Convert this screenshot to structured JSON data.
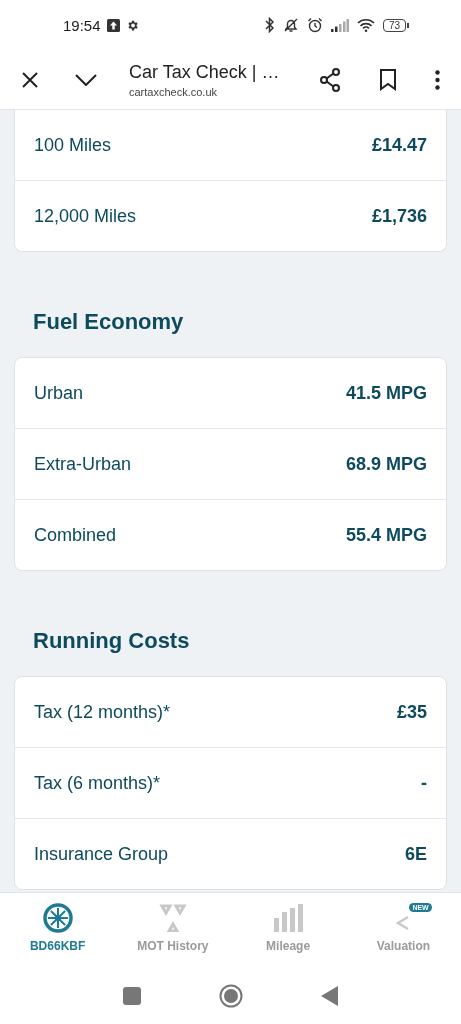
{
  "status_bar": {
    "time": "19:54",
    "battery": "73"
  },
  "toolbar": {
    "title": "Car Tax Check | …",
    "url": "cartaxcheck.co.uk"
  },
  "sections": [
    {
      "rows": [
        {
          "label": "100 Miles",
          "value": "£14.47"
        },
        {
          "label": "12,000 Miles",
          "value": "£1,736"
        }
      ]
    },
    {
      "heading": "Fuel Economy",
      "rows": [
        {
          "label": "Urban",
          "value": "41.5 MPG"
        },
        {
          "label": "Extra-Urban",
          "value": "68.9 MPG"
        },
        {
          "label": "Combined",
          "value": "55.4 MPG"
        }
      ]
    },
    {
      "heading": "Running Costs",
      "rows": [
        {
          "label": "Tax (12 months)*",
          "value": "£35"
        },
        {
          "label": "Tax (6 months)*",
          "value": "-"
        },
        {
          "label": "Insurance Group",
          "value": "6E"
        }
      ]
    }
  ],
  "bottom_nav": [
    {
      "kind": "wheel",
      "label": "BD66KBF",
      "selected": true
    },
    {
      "kind": "mot",
      "label": "MOT History",
      "selected": false
    },
    {
      "kind": "bars",
      "label": "Mileage",
      "selected": false
    },
    {
      "kind": "valuation",
      "label": "Valuation",
      "selected": false,
      "badge": "NEW"
    }
  ]
}
